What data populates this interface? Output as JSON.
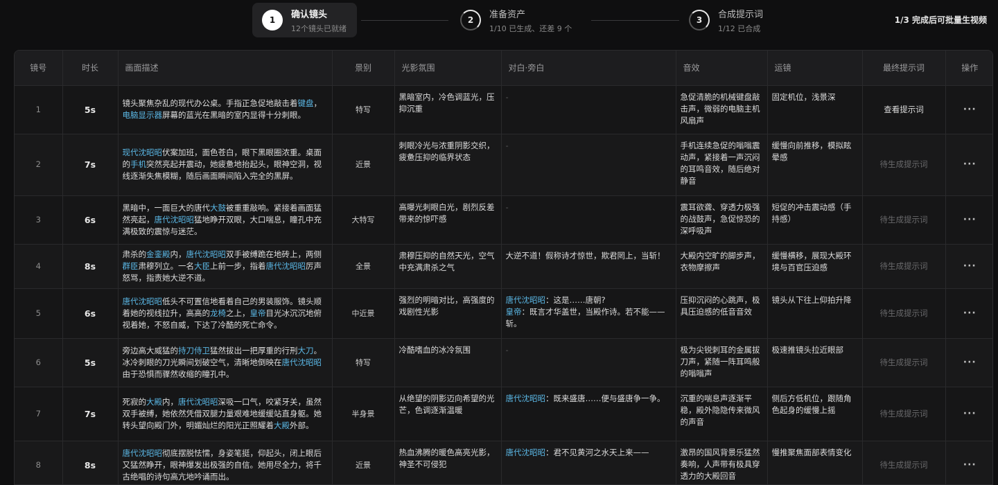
{
  "steps": [
    {
      "num": "1",
      "title": "确认镜头",
      "subtitle": "12个镜头已就绪"
    },
    {
      "num": "2",
      "title": "准备资产",
      "subtitle": "1/10 已生成、还差 9 个"
    },
    {
      "num": "3",
      "title": "合成提示词",
      "subtitle": "1/12 已合成"
    }
  ],
  "top_right_note": "1/3 完成后可批量生视频",
  "columns": [
    "镜号",
    "时长",
    "画面描述",
    "景别",
    "光影氛围",
    "对白·旁白",
    "音效",
    "运镜",
    "最终提示词",
    "操作"
  ],
  "rows": [
    {
      "num": "1",
      "duration": "5s",
      "description": [
        {
          "t": "镜头聚焦杂乱的现代办公桌。手指正急促地敲击着"
        },
        {
          "t": "键盘",
          "h": true
        },
        {
          "t": "，"
        },
        {
          "t": "电脑显示器",
          "h": true
        },
        {
          "t": "屏幕的蓝光在黑暗的室内显得十分刺眼。"
        }
      ],
      "shot": "特写",
      "lighting": "黑暗室内，冷色调蓝光，压抑沉重",
      "dialogue": [
        {
          "t": "-",
          "d": true
        }
      ],
      "sound": "急促清脆的机械键盘敲击声，微弱的电脑主机风扇声",
      "camera": "固定机位，浅景深",
      "prompt": "查看提示词",
      "prompt_state": "view",
      "op": "···"
    },
    {
      "num": "2",
      "duration": "7s",
      "description": [
        {
          "t": "现代沈昭昭",
          "h": true
        },
        {
          "t": "伏案加班，面色苍白，眼下黑眼圈浓重。桌面的"
        },
        {
          "t": "手机",
          "h": true
        },
        {
          "t": "突然亮起并震动，她疲惫地抬起头，眼神空洞，视线逐渐失焦模糊，随后画面瞬间陷入完全的黑屏。"
        }
      ],
      "shot": "近景",
      "lighting": "刺眼冷光与浓重阴影交织，疲惫压抑的临界状态",
      "dialogue": [
        {
          "t": "-",
          "d": true
        }
      ],
      "sound": "手机连续急促的嗡嗡震动声，紧接着一声沉闷的耳鸣音效，随后绝对静音",
      "camera": "缓慢向前推移，模拟眩晕感",
      "prompt": "待生成提示词",
      "prompt_state": "pending",
      "op": "···"
    },
    {
      "num": "3",
      "duration": "6s",
      "description": [
        {
          "t": "黑暗中，一面巨大的唐代"
        },
        {
          "t": "大鼓",
          "h": true
        },
        {
          "t": "被重重敲响。紧接着画面猛然亮起，"
        },
        {
          "t": "唐代沈昭昭",
          "h": true
        },
        {
          "t": "猛地睁开双眼，大口喘息，瞳孔中充满极致的震惊与迷茫。"
        }
      ],
      "shot": "大特写",
      "lighting": "高曝光刺眼白光，剧烈反差带来的惊吓感",
      "dialogue": [
        {
          "t": "-",
          "d": true
        }
      ],
      "sound": "震耳欲聋、穿透力极强的战鼓声，急促惊恐的深呼吸声",
      "camera": "短促的冲击震动感（手持感）",
      "prompt": "待生成提示词",
      "prompt_state": "pending",
      "op": "···"
    },
    {
      "num": "4",
      "duration": "8s",
      "description": [
        {
          "t": "肃杀的"
        },
        {
          "t": "金銮殿",
          "h": true
        },
        {
          "t": "内，"
        },
        {
          "t": "唐代沈昭昭",
          "h": true
        },
        {
          "t": "双手被缚跪在地砖上，两侧"
        },
        {
          "t": "群臣",
          "h": true
        },
        {
          "t": "肃穆列立。一名"
        },
        {
          "t": "大臣",
          "h": true
        },
        {
          "t": "上前一步，指着"
        },
        {
          "t": "唐代沈昭昭",
          "h": true
        },
        {
          "t": "厉声怒骂，指责她大逆不道。"
        }
      ],
      "shot": "全景",
      "lighting": "肃穆压抑的自然天光，空气中充满肃杀之气",
      "dialogue": [
        {
          "t": "大逆不道！假称诗才惊世，欺君罔上，当斩！"
        }
      ],
      "sound": "大殿内空旷的脚步声，衣物摩擦声",
      "camera": "缓慢横移，展现大殿环境与百官压迫感",
      "prompt": "待生成提示词",
      "prompt_state": "pending",
      "op": "···"
    },
    {
      "num": "5",
      "duration": "6s",
      "description": [
        {
          "t": "唐代沈昭昭",
          "h": true
        },
        {
          "t": "低头不可置信地看着自己的男装服饰。镜头顺着她的视线拉升，高高的"
        },
        {
          "t": "龙椅",
          "h": true
        },
        {
          "t": "之上，"
        },
        {
          "t": "皇帝",
          "h": true
        },
        {
          "t": "目光冰沉沉地俯视着她，不怒自威，下达了冷酷的死亡命令。"
        }
      ],
      "shot": "中近景",
      "lighting": "强烈的明暗对比，高强度的戏剧性光影",
      "dialogue": [
        {
          "t": "唐代沈昭昭",
          "h": true
        },
        {
          "t": "：这是……唐朝?\n"
        },
        {
          "t": "皇帝",
          "h": true
        },
        {
          "t": "：既言才华盖世，当殿作诗。若不能——斩。"
        }
      ],
      "sound": "压抑沉闷的心跳声，极具压迫感的低音音效",
      "camera": "镜头从下往上仰拍升降",
      "prompt": "待生成提示词",
      "prompt_state": "pending",
      "op": "···"
    },
    {
      "num": "6",
      "duration": "5s",
      "description": [
        {
          "t": "旁边高大威猛的"
        },
        {
          "t": "持刀侍卫",
          "h": true
        },
        {
          "t": "猛然拔出一把厚重的行刑"
        },
        {
          "t": "大刀",
          "h": true
        },
        {
          "t": "。冰冷刺眼的刀光瞬间划破空气，清晰地倒映在"
        },
        {
          "t": "唐代沈昭昭",
          "h": true
        },
        {
          "t": "由于恐惧而骤然收缩的瞳孔中。"
        }
      ],
      "shot": "特写",
      "lighting": "冷酷嗜血的冰冷氛围",
      "dialogue": [
        {
          "t": "-",
          "d": true
        }
      ],
      "sound": "极为尖锐刺耳的金属拔刀声，紧随一阵耳鸣般的嗡嗡声",
      "camera": "极速推镜头拉近眼部",
      "prompt": "待生成提示词",
      "prompt_state": "pending",
      "op": "···"
    },
    {
      "num": "7",
      "duration": "7s",
      "description": [
        {
          "t": "死寂的"
        },
        {
          "t": "大殿",
          "h": true
        },
        {
          "t": "内，"
        },
        {
          "t": "唐代沈昭昭",
          "h": true
        },
        {
          "t": "深吸一口气，咬紧牙关，虽然双手被缚，她依然凭借双腿力量艰难地缓缓站直身躯。她转头望向殿门外，明媚灿烂的阳光正照耀着"
        },
        {
          "t": "大殿",
          "h": true
        },
        {
          "t": "外部。"
        }
      ],
      "shot": "半身景",
      "lighting": "从绝望的阴影迈向希望的光芒，色调逐渐温暖",
      "dialogue": [
        {
          "t": "唐代沈昭昭",
          "h": true
        },
        {
          "t": "：既来盛唐……便与盛唐争一争。"
        }
      ],
      "sound": "沉重的喘息声逐渐平稳，殿外隐隐传来微风的声音",
      "camera": "侧后方低机位，跟随角色起身的缓慢上摇",
      "prompt": "待生成提示词",
      "prompt_state": "pending",
      "op": "···"
    },
    {
      "num": "8",
      "duration": "8s",
      "description": [
        {
          "t": "唐代沈昭昭",
          "h": true
        },
        {
          "t": "彻底摆脱怯懦，身姿笔挺，仰起头，闭上眼后又猛然睁开，眼神爆发出极强的自信。她用尽全力，将千古绝唱的诗句高亢地吟诵而出。"
        }
      ],
      "shot": "近景",
      "lighting": "热血沸腾的暖色高亮光影，神圣不可侵犯",
      "dialogue": [
        {
          "t": "唐代沈昭昭",
          "h": true
        },
        {
          "t": "：君不见黄河之水天上来——"
        }
      ],
      "sound": "激昂的国风背景乐猛然奏响，人声带有极具穿透力的大殿回音",
      "camera": "慢推聚焦面部表情变化",
      "prompt": "待生成提示词",
      "prompt_state": "pending",
      "op": "···"
    }
  ]
}
